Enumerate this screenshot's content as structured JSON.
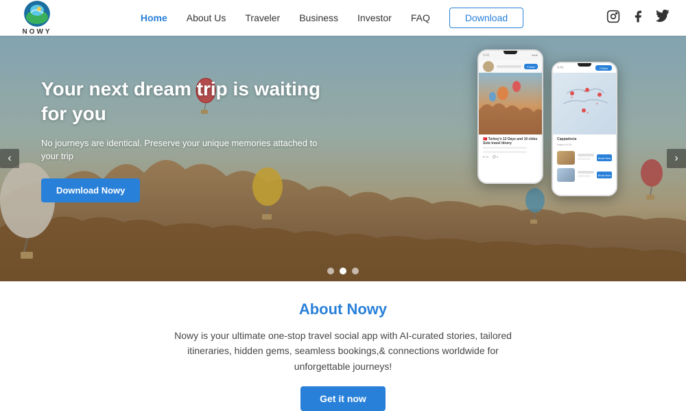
{
  "navbar": {
    "logo_text": "NOWY",
    "links": [
      {
        "label": "Home",
        "active": true
      },
      {
        "label": "About Us",
        "active": false
      },
      {
        "label": "Traveler",
        "active": false
      },
      {
        "label": "Business",
        "active": false
      },
      {
        "label": "Investor",
        "active": false
      },
      {
        "label": "FAQ",
        "active": false
      }
    ],
    "download_label": "Download",
    "social": [
      "instagram-icon",
      "facebook-icon",
      "twitter-icon"
    ]
  },
  "hero": {
    "title": "Your next dream trip is waiting for you",
    "subtitle": "No journeys are identical. Preserve your unique memories attached to your trip",
    "cta_label": "Download Nowy",
    "carousel_dots": 3,
    "active_dot": 1
  },
  "about": {
    "title": "About Nowy",
    "text": "Nowy is your ultimate one-stop travel social app with AI-curated stories, tailored itineraries, hidden gems, seamless bookings,& connections worldwide for unforgettable journeys!",
    "cta_label": "Get it now"
  }
}
